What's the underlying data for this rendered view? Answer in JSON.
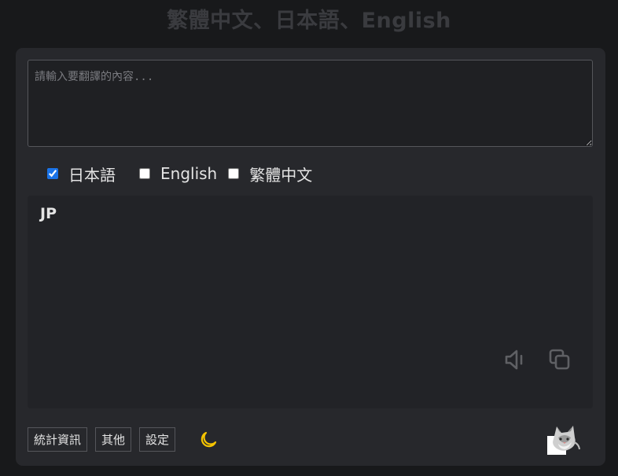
{
  "header": {
    "title": "繁體中文、日本語、English"
  },
  "input": {
    "placeholder": "請輸入要翻譯的內容...",
    "value": ""
  },
  "languages": [
    {
      "label": "日本語",
      "checked": true
    },
    {
      "label": "English",
      "checked": false
    },
    {
      "label": "繁體中文",
      "checked": false
    }
  ],
  "result": {
    "tag": "JP"
  },
  "icons": {
    "speaker": "speaker-icon",
    "copy": "copy-icon",
    "theme": "moon-icon",
    "mascot": "cat-mascot-icon"
  },
  "footer": {
    "stats_label": "統計資訊",
    "other_label": "其他",
    "settings_label": "設定"
  },
  "colors": {
    "background": "#18191b",
    "panel": "#27282c",
    "accent": "#1a73e8",
    "moon": "#f5c400"
  }
}
